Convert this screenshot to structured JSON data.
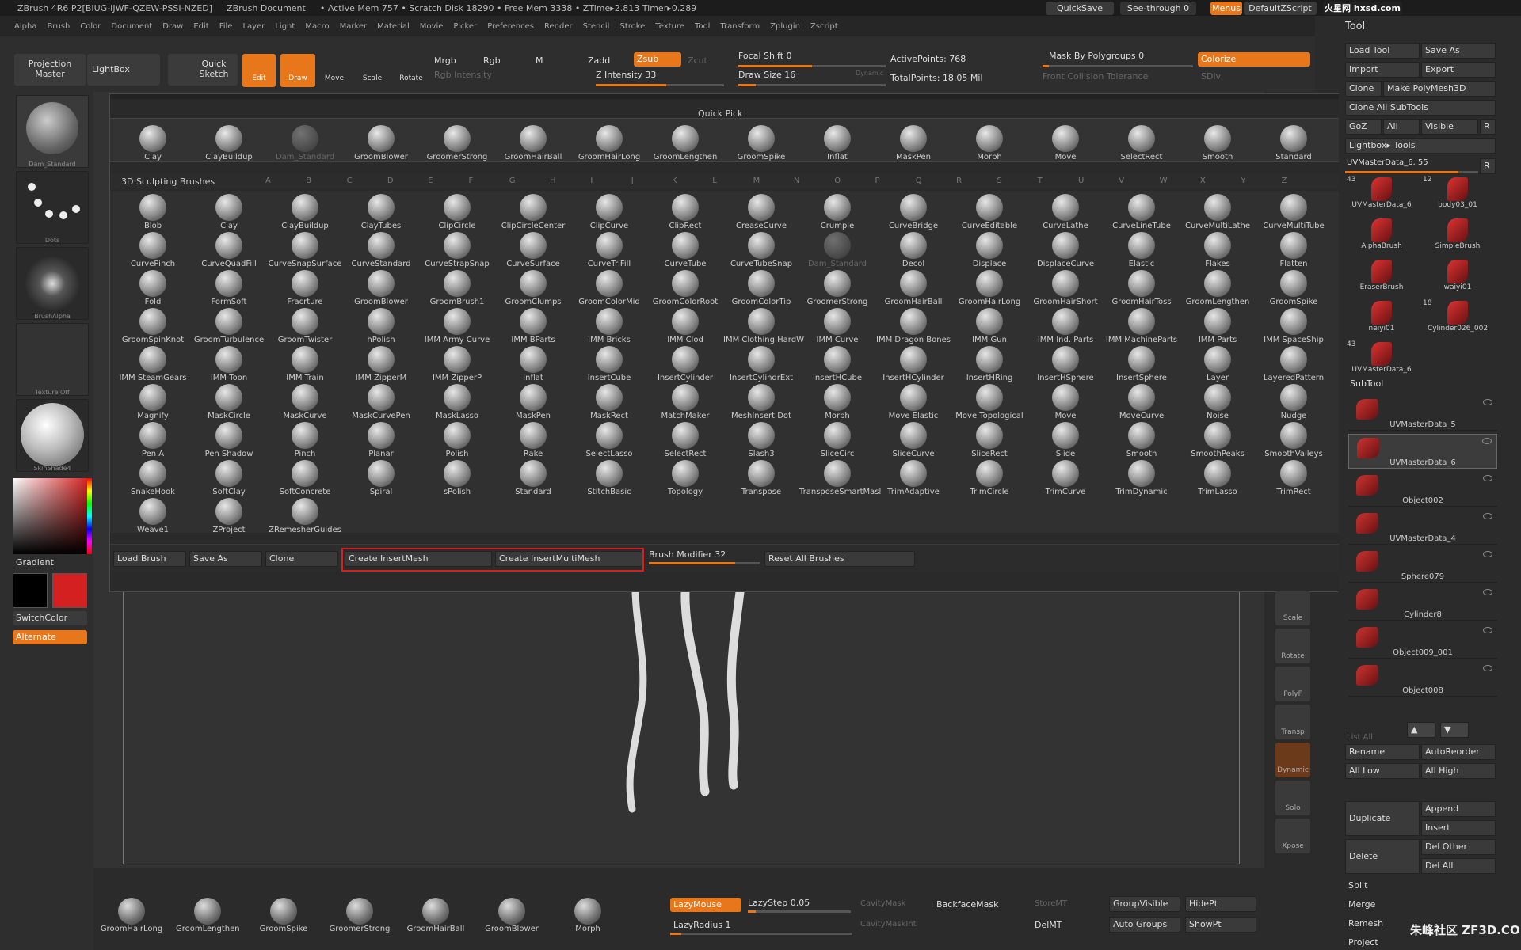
{
  "titlebar": {
    "app": "ZBrush 4R6 P2[BIUG-IJWF-QZEW-PSSI-NZED]",
    "document": "ZBrush Document",
    "stats": "• Active Mem 757 • Scratch Disk 18290 • Free Mem 3338 • ZTime▸2.813 Timer▸0.289",
    "quicksave": "QuickSave",
    "seethrough": "See-through 0",
    "menus": "Menus",
    "script": "DefaultZScript",
    "watermark": "火星网 hxsd.com"
  },
  "menubar": [
    "Alpha",
    "Brush",
    "Color",
    "Document",
    "Draw",
    "Edit",
    "File",
    "Layer",
    "Light",
    "Macro",
    "Marker",
    "Material",
    "Movie",
    "Picker",
    "Preferences",
    "Render",
    "Stencil",
    "Stroke",
    "Texture",
    "Tool",
    "Transform",
    "Zplugin",
    "Zscript"
  ],
  "toolbar": {
    "projection_master": "Projection Master",
    "lightbox": "LightBox",
    "quick_sketch": "Quick Sketch",
    "edit": "Edit",
    "draw": "Draw",
    "move": "Move",
    "scale": "Scale",
    "rotate": "Rotate",
    "mrgb": "Mrgb",
    "rgb": "Rgb",
    "m": "M",
    "rgb_intensity": "Rgb Intensity",
    "zadd": "Zadd",
    "zsub": "Zsub",
    "zcut": "Zcut",
    "z_intensity": "Z Intensity 33",
    "focal_shift": "Focal Shift 0",
    "draw_size": "Draw Size 16",
    "dynamic": "Dynamic",
    "active_points": "ActivePoints: 768",
    "total_points": "TotalPoints: 18.05 Mil",
    "mask_polygroups": "Mask By Polygroups 0",
    "front_collision": "Front Collision Tolerance",
    "colorize": "Colorize",
    "sdiv": "SDiv"
  },
  "leftpanel": {
    "thumbs": [
      "Dam_Standard",
      "Dots",
      "BrushAlpha",
      "Texture Off",
      "SkinShade4"
    ],
    "gradient": "Gradient",
    "switchcolor": "SwitchColor",
    "alternate": "Alternate"
  },
  "popup": {
    "quick_pick_title": "Quick Pick",
    "quick_pick": [
      "Clay",
      "ClayBuildup",
      "Dam_Standard",
      "GroomBlower",
      "GroomerStrong",
      "GroomHairBall",
      "GroomHairLong",
      "GroomLengthen",
      "GroomSpike",
      "Inflat",
      "MaskPen",
      "Morph",
      "Move",
      "SelectRect",
      "Smooth",
      "Standard"
    ],
    "brushes_title": "3D Sculpting Brushes",
    "letters": [
      "A",
      "B",
      "C",
      "D",
      "E",
      "F",
      "G",
      "H",
      "I",
      "J",
      "K",
      "L",
      "M",
      "N",
      "O",
      "P",
      "Q",
      "R",
      "S",
      "T",
      "U",
      "V",
      "W",
      "X",
      "Y",
      "Z"
    ],
    "brushes": [
      "Blob",
      "Clay",
      "ClayBuildup",
      "ClayTubes",
      "ClipCircle",
      "ClipCircleCenter",
      "ClipCurve",
      "ClipRect",
      "CreaseCurve",
      "Crumple",
      "CurveBridge",
      "CurveEditable",
      "CurveLathe",
      "CurveLineTube",
      "CurveMultiLathe",
      "CurveMultiTube",
      "CurvePinch",
      "CurveQuadFill",
      "CurveSnapSurface",
      "CurveStandard",
      "CurveStrapSnap",
      "CurveSurface",
      "CurveTriFill",
      "CurveTube",
      "CurveTubeSnap",
      "Dam_Standard",
      "Decol",
      "Displace",
      "DisplaceCurve",
      "Elastic",
      "Flakes",
      "Flatten",
      "Fold",
      "FormSoft",
      "Fracrture",
      "GroomBlower",
      "GroomBrush1",
      "GroomClumps",
      "GroomColorMid",
      "GroomColorRoot",
      "GroomColorTip",
      "GroomerStrong",
      "GroomHairBall",
      "GroomHairLong",
      "GroomHairShort",
      "GroomHairToss",
      "GroomLengthen",
      "GroomSpike",
      "GroomSpinKnot",
      "GroomTurbulence",
      "GroomTwister",
      "hPolish",
      "IMM Army Curve",
      "IMM BParts",
      "IMM Bricks",
      "IMM Clod",
      "IMM Clothing HardW",
      "IMM Curve",
      "IMM Dragon Bones",
      "IMM Gun",
      "IMM Ind. Parts",
      "IMM MachineParts",
      "IMM Parts",
      "IMM SpaceShip",
      "IMM SteamGears",
      "IMM Toon",
      "IMM Train",
      "IMM ZipperM",
      "IMM ZipperP",
      "Inflat",
      "InsertCube",
      "InsertCylinder",
      "InsertCylindrExt",
      "InsertHCube",
      "InsertHCylinder",
      "InsertHRing",
      "InsertHSphere",
      "InsertSphere",
      "Layer",
      "LayeredPattern",
      "Magnify",
      "MaskCircle",
      "MaskCurve",
      "MaskCurvePen",
      "MaskLasso",
      "MaskPen",
      "MaskRect",
      "MatchMaker",
      "MeshInsert Dot",
      "Morph",
      "Move Elastic",
      "Move Topological",
      "Move",
      "MoveCurve",
      "Noise",
      "Nudge",
      "Pen A",
      "Pen Shadow",
      "Pinch",
      "Planar",
      "Polish",
      "Rake",
      "SelectLasso",
      "SelectRect",
      "Slash3",
      "SliceCirc",
      "SliceCurve",
      "SliceRect",
      "Slide",
      "Smooth",
      "SmoothPeaks",
      "SmoothValleys",
      "SnakeHook",
      "SoftClay",
      "SoftConcrete",
      "Spiral",
      "sPolish",
      "Standard",
      "StitchBasic",
      "Topology",
      "Transpose",
      "TransposeSmartMasl",
      "TrimAdaptive",
      "TrimCircle",
      "TrimCurve",
      "TrimDynamic",
      "TrimLasso",
      "TrimRect",
      "Weave1",
      "ZProject",
      "ZRemesherGuides"
    ],
    "bottom": {
      "load_brush": "Load Brush",
      "save_as": "Save As",
      "clone": "Clone",
      "create_insertmesh": "Create InsertMesh",
      "create_insertmultimesh": "Create InsertMultiMesh",
      "brush_modifier": "Brush Modifier 32",
      "reset_all": "Reset All Brushes"
    }
  },
  "rightdock": [
    "Scale",
    "Rotate",
    "PolyF",
    "Transp",
    "Dynamic",
    "Solo",
    "Xpose"
  ],
  "rightpanel": {
    "tool": "Tool",
    "load_tool": "Load Tool",
    "save_as": "Save As",
    "import": "Import",
    "export": "Export",
    "clone": "Clone",
    "make_polymesh": "Make PolyMesh3D",
    "clone_all": "Clone All SubTools",
    "goz": "GoZ",
    "all": "All",
    "visible": "Visible",
    "r": "R",
    "lightbox_tools": "Lightbox▸ Tools",
    "current": "UVMasterData_6. 55",
    "tool_thumbs": [
      {
        "n": "43",
        "label": "UVMasterData_6"
      },
      {
        "n": "12",
        "label": "body03_01"
      },
      {
        "n": "",
        "label": "AlphaBrush"
      },
      {
        "n": "",
        "label": "SimpleBrush"
      },
      {
        "n": "",
        "label": "EraserBrush"
      },
      {
        "n": "",
        "label": "waiyi01"
      },
      {
        "n": "",
        "label": "neiyi01"
      },
      {
        "n": "18",
        "label": "Cylinder026_002"
      },
      {
        "n": "43",
        "label": "UVMasterData_6"
      }
    ],
    "subtool": "SubTool",
    "subtools": [
      "UVMasterData_5",
      "UVMasterData_6",
      "Object002",
      "UVMasterData_4",
      "Sphere079",
      "Cylinder8",
      "Object009_001",
      "Object008"
    ],
    "list_all": "List All",
    "rename": "Rename",
    "autoreorder": "AutoReorder",
    "all_low": "All Low",
    "all_high": "All High",
    "duplicate": "Duplicate",
    "append": "Append",
    "insert": "Insert",
    "delete": "Delete",
    "del_other": "Del Other",
    "del_all": "Del All",
    "split": "Split",
    "merge": "Merge",
    "remesh": "Remesh",
    "project": "Project",
    "watermark2": "朱峰社区 ZF3D.COM"
  },
  "bottombar": {
    "brushes": [
      "GroomHairLong",
      "GroomLengthen",
      "GroomSpike",
      "GroomerStrong",
      "GroomHairBall",
      "GroomBlower",
      "Morph"
    ],
    "lazymouse": "LazyMouse",
    "lazystep": "LazyStep 0.05",
    "lazyradius": "LazyRadius 1",
    "cavitymask": "CavityMask",
    "cavitymaskint": "CavityMaskInt",
    "backfacemask": "BackfaceMask",
    "storemt": "StoreMT",
    "delmt": "DelMT",
    "groupvisible": "GroupVisible",
    "autogroups": "Auto Groups",
    "hidept": "HidePt",
    "showpt": "ShowPt"
  },
  "colors": {
    "accent": "#e8761b",
    "highlight_box": "#d42020",
    "primary_color": "#000000",
    "secondary_color": "#d42020"
  }
}
